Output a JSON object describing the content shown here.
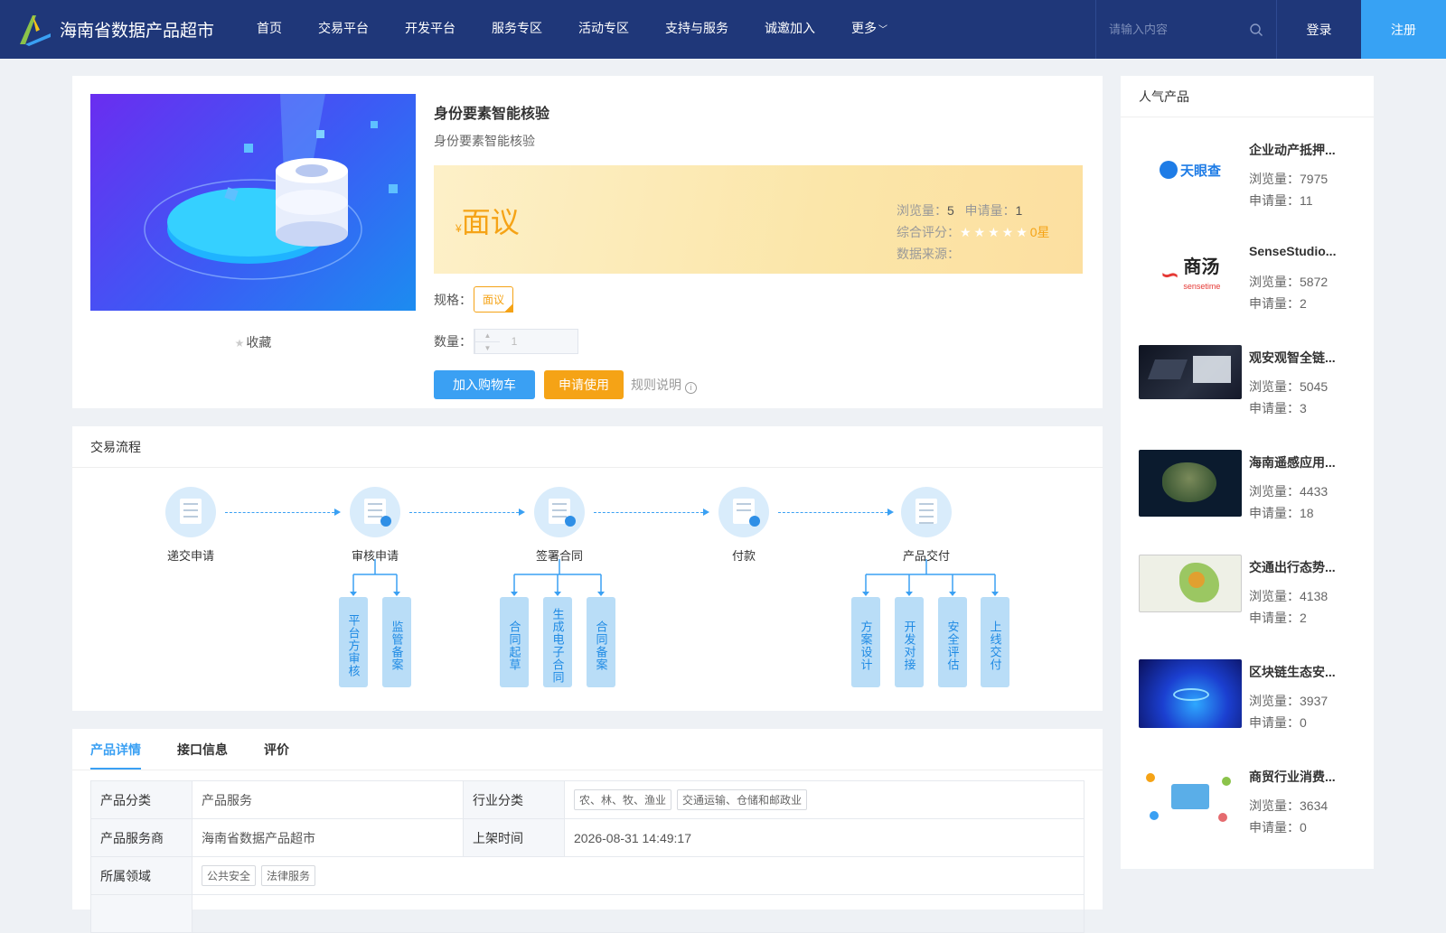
{
  "header": {
    "logo_text": "海南省数据产品超市",
    "nav": [
      "首页",
      "交易平台",
      "开发平台",
      "服务专区",
      "活动专区",
      "支持与服务",
      "诚邀加入",
      "更多"
    ],
    "search_placeholder": "请输入内容",
    "login": "登录",
    "register": "注册"
  },
  "product": {
    "favorite": "收藏",
    "title": "身份要素智能核验",
    "subtitle": "身份要素智能核验",
    "currency": "¥",
    "price": "面议",
    "views_label": "浏览量：",
    "views": "5",
    "applies_label": "申请量：",
    "applies": "1",
    "rating_label": "综合评分：",
    "rating_stars": "★★★★★",
    "rating": "0星",
    "source_label": "数据来源：",
    "spec_label": "规格：",
    "spec": "面议",
    "qty_label": "数量：",
    "qty": "1",
    "add_cart": "加入购物车",
    "apply": "申请使用",
    "rules": "规则说明"
  },
  "flow": {
    "title": "交易流程",
    "steps": [
      "递交申请",
      "审核申请",
      "签署合同",
      "付款",
      "产品交付"
    ],
    "sub_review": [
      "平台方审核",
      "监管备案"
    ],
    "sub_contract": [
      "合同起草",
      "生成电子合同",
      "合同备案"
    ],
    "sub_delivery": [
      "方案设计",
      "开发对接",
      "安全评估",
      "上线交付"
    ]
  },
  "details": {
    "tabs": [
      "产品详情",
      "接口信息",
      "评价"
    ],
    "rows": {
      "category_k": "产品分类",
      "category_v": "产品服务",
      "industry_k": "行业分类",
      "industry_tags": [
        "农、林、牧、渔业",
        "交通运输、仓储和邮政业"
      ],
      "provider_k": "产品服务商",
      "provider_v": "海南省数据产品超市",
      "time_k": "上架时间",
      "time_v": "2026-08-31 14:49:17",
      "domain_k": "所属领域",
      "domain_tags": [
        "公共安全",
        "法律服务"
      ]
    }
  },
  "sidebar": {
    "title": "人气产品",
    "items": [
      {
        "name": "企业动产抵押...",
        "views": "浏览量：7975",
        "applies": "申请量：11",
        "thumb": "tianyancha-logo"
      },
      {
        "name": "SenseStudio...",
        "views": "浏览量：5872",
        "applies": "申请量：2",
        "thumb": "sensetime-logo"
      },
      {
        "name": "观安观智全链...",
        "views": "浏览量：5045",
        "applies": "申请量：3",
        "thumb": "device-photo"
      },
      {
        "name": "海南遥感应用...",
        "views": "浏览量：4433",
        "applies": "申请量：18",
        "thumb": "satellite-map"
      },
      {
        "name": "交通出行态势...",
        "views": "浏览量：4138",
        "applies": "申请量：2",
        "thumb": "traffic-map"
      },
      {
        "name": "区块链生态安...",
        "views": "浏览量：3937",
        "applies": "申请量：0",
        "thumb": "blockchain-image"
      },
      {
        "name": "商贸行业消费...",
        "views": "浏览量：3634",
        "applies": "申请量：0",
        "thumb": "commerce-illustration"
      }
    ],
    "tianyancha_text": "天眼查",
    "sensetime_text": "商汤",
    "sensetime_sub": "sensetime"
  },
  "colors": {
    "nav_bg": "#1f3779",
    "accent": "#3aa0f3",
    "orange": "#f5a316"
  }
}
